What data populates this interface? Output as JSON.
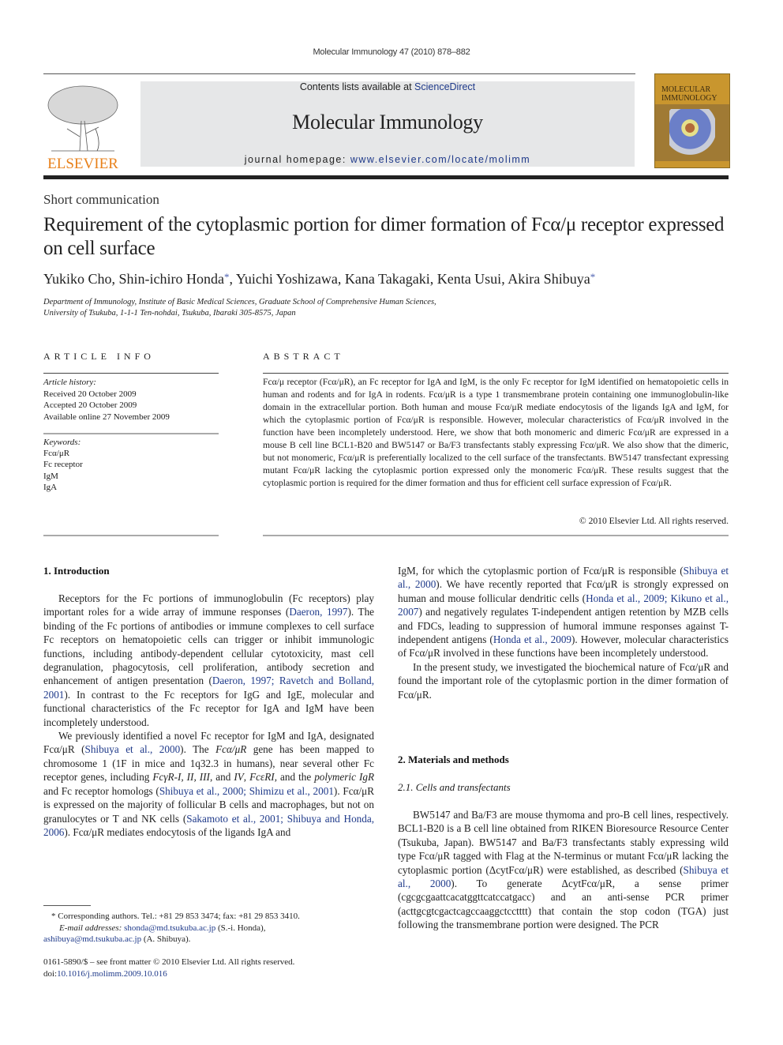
{
  "header": {
    "running_head": "Molecular Immunology 47 (2010) 878–882",
    "contents_prefix": "Contents lists available at ",
    "contents_link": "ScienceDirect",
    "journal_title": "Molecular Immunology",
    "homepage_prefix": "journal homepage: ",
    "homepage_url": "www.elsevier.com/locate/molimm",
    "publisher_logo_text": "ELSEVIER",
    "cover_title_line1": "MOLECULAR",
    "cover_title_line2": "IMMUNOLOGY",
    "colors": {
      "elsevier_orange": "#e8811b",
      "link_blue": "#1f3a8a",
      "banner_grey": "#e6e7e8",
      "cover_gold": "#c9962e"
    }
  },
  "article": {
    "type": "Short communication",
    "title": "Requirement of the cytoplasmic portion for dimer formation of Fcα/μ receptor expressed on cell surface",
    "authors": [
      {
        "name": "Yukiko Cho",
        "corresponding": false
      },
      {
        "name": "Shin-ichiro Honda",
        "corresponding": true
      },
      {
        "name": "Yuichi Yoshizawa",
        "corresponding": false
      },
      {
        "name": "Kana Takagaki",
        "corresponding": false
      },
      {
        "name": "Kenta Usui",
        "corresponding": false
      },
      {
        "name": "Akira Shibuya",
        "corresponding": true
      }
    ],
    "affiliation_line1": "Department of Immunology, Institute of Basic Medical Sciences, Graduate School of Comprehensive Human Sciences,",
    "affiliation_line2": "University of Tsukuba, 1-1-1 Ten-nohdai, Tsukuba, Ibaraki 305-8575, Japan"
  },
  "article_info": {
    "label": "ARTICLE INFO",
    "history_label": "Article history:",
    "history": [
      "Received 20 October 2009",
      "Accepted 20 October 2009",
      "Available online 27 November 2009"
    ],
    "keywords_label": "Keywords:",
    "keywords": [
      "Fcα/μR",
      "Fc receptor",
      "IgM",
      "IgA"
    ]
  },
  "abstract": {
    "label": "ABSTRACT",
    "text": "Fcα/μ receptor (Fcα/μR), an Fc receptor for IgA and IgM, is the only Fc receptor for IgM identified on hematopoietic cells in human and rodents and for IgA in rodents. Fcα/μR is a type 1 transmembrane protein containing one immunoglobulin-like domain in the extracellular portion. Both human and mouse Fcα/μR mediate endocytosis of the ligands IgA and IgM, for which the cytoplasmic portion of Fcα/μR is responsible. However, molecular characteristics of Fcα/μR involved in the function have been incompletely understood. Here, we show that both monomeric and dimeric Fcα/μR are expressed in a mouse B cell line BCL1-B20 and BW5147 or Ba/F3 transfectants stably expressing Fcα/μR. We also show that the dimeric, but not monomeric, Fcα/μR is preferentially localized to the cell surface of the transfectants. BW5147 transfectant expressing mutant Fcα/μR lacking the cytoplasmic portion expressed only the monomeric Fcα/μR. These results suggest that the cytoplasmic portion is required for the dimer formation and thus for efficient cell surface expression of Fcα/μR.",
    "copyright": "© 2010 Elsevier Ltd. All rights reserved."
  },
  "introduction": {
    "heading": "1.  Introduction",
    "p1": [
      {
        "t": "Receptors for the Fc portions of immunoglobulin (Fc receptors) play important roles for a wide array of immune responses ("
      },
      {
        "t": "Daeron, 1997",
        "link": true
      },
      {
        "t": "). The binding of the Fc portions of antibodies or immune complexes to cell surface Fc receptors on hematopoietic cells can trigger or inhibit immunologic functions, including antibody-dependent cellular cytotoxicity, mast cell degranulation, phagocytosis, cell proliferation, antibody secretion and enhancement of antigen presentation ("
      },
      {
        "t": "Daeron, 1997; Ravetch and Bolland, 2001",
        "link": true
      },
      {
        "t": "). In contrast to the Fc receptors for IgG and IgE, molecular and functional characteristics of the Fc receptor for IgA and IgM have been incompletely understood."
      }
    ],
    "p2": [
      {
        "t": "We previously identified a novel Fc receptor for IgM and IgA, designated Fcα/μR ("
      },
      {
        "t": "Shibuya et al., 2000",
        "link": true
      },
      {
        "t": "). The "
      },
      {
        "t": "Fcα/μR",
        "italic": true
      },
      {
        "t": " gene has been mapped to chromosome 1 (1F in mice and 1q32.3 in humans), near several other Fc receptor genes, including "
      },
      {
        "t": "FcγR-I, II, III",
        "italic": true
      },
      {
        "t": ", and "
      },
      {
        "t": "IV",
        "italic": true
      },
      {
        "t": ", "
      },
      {
        "t": "FcεRI",
        "italic": true
      },
      {
        "t": ", and the "
      },
      {
        "t": "polymeric IgR",
        "italic": true
      },
      {
        "t": " and Fc receptor homologs ("
      },
      {
        "t": "Shibuya et al., 2000; Shimizu et al., 2001",
        "link": true
      },
      {
        "t": "). Fcα/μR is expressed on the majority of follicular B cells and macrophages, but not on granulocytes or T and NK cells ("
      },
      {
        "t": "Sakamoto et al., 2001; Shibuya and Honda, 2006",
        "link": true
      },
      {
        "t": "). Fcα/μR mediates endocytosis of the ligands IgA and IgM, for which the cytoplasmic portion of Fcα/μR is responsible ("
      },
      {
        "t": "Shibuya et al., 2000",
        "link": true
      },
      {
        "t": "). We have recently reported that Fcα/μR is strongly expressed on human and mouse follicular dendritic cells ("
      },
      {
        "t": "Honda et al., 2009; Kikuno et al., 2007",
        "link": true
      },
      {
        "t": ") and negatively regulates T-independent antigen retention by MZB cells and FDCs, leading to suppression of humoral immune responses against T-independent antigens ("
      },
      {
        "t": "Honda et al., 2009",
        "link": true
      },
      {
        "t": "). However, molecular characteristics of Fcα/μR involved in these functions have been incompletely understood."
      }
    ],
    "p3": [
      {
        "t": "In the present study, we investigated the biochemical nature of Fcα/μR and found the important role of the cytoplasmic portion in the dimer formation of Fcα/μR."
      }
    ]
  },
  "methods": {
    "heading": "2.  Materials and methods",
    "subheading": "2.1.  Cells and transfectants",
    "p1": [
      {
        "t": "BW5147 and Ba/F3 are mouse thymoma and pro-B cell lines, respectively. BCL1-B20 is a B cell line obtained from RIKEN Bioresource Resource Center (Tsukuba, Japan). BW5147 and Ba/F3 transfectants stably expressing wild type Fcα/μR tagged with Flag at the N-terminus or mutant Fcα/μR lacking the cytoplasmic portion (ΔcytFcα/μR) were established, as described ("
      },
      {
        "t": "Shibuya et al., 2000",
        "link": true
      },
      {
        "t": "). To generate ΔcytFcα/μR, a sense primer (cgcgcgaattcacatggttcatccatgacc) and an anti-sense PCR primer (acttgcgtcgactcagccaaggctcctttt) that contain the stop codon (TGA) just following the transmembrane portion were designed. The PCR"
      }
    ]
  },
  "footnote": {
    "corresponding": "*  Corresponding authors. Tel.: +81 29 853 3474; fax: +81 29 853 3410.",
    "email_label": "E-mail addresses: ",
    "email1": "shonda@md.tsukuba.ac.jp",
    "email1_who": " (S.-i. Honda),",
    "email2": "ashibuya@md.tsukuba.ac.jp",
    "email2_who": " (A. Shibuya).",
    "front_matter": "0161-5890/$ – see front matter © 2010 Elsevier Ltd. All rights reserved.",
    "doi_label": "doi:",
    "doi": "10.1016/j.molimm.2009.10.016"
  }
}
